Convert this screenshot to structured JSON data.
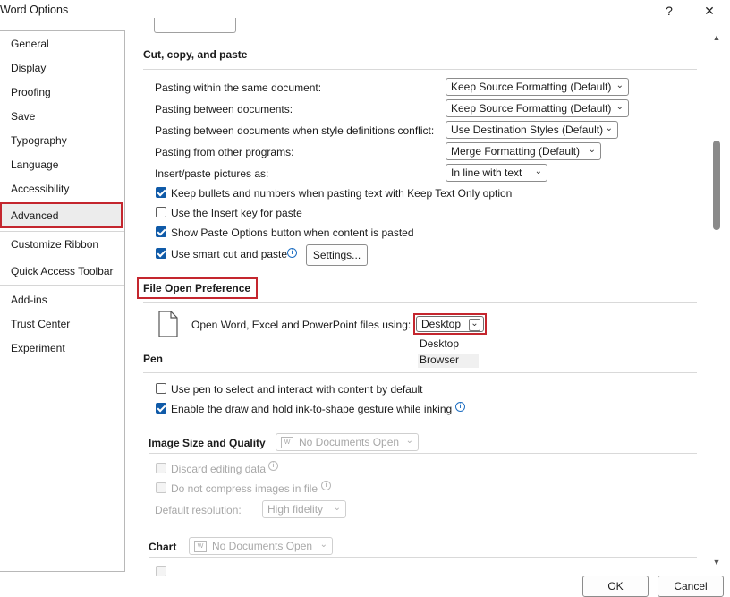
{
  "window": {
    "title": "Word Options",
    "help_glyph": "?",
    "close_glyph": "✕"
  },
  "sidebar": {
    "items": [
      {
        "label": "General"
      },
      {
        "label": "Display"
      },
      {
        "label": "Proofing"
      },
      {
        "label": "Save"
      },
      {
        "label": "Typography"
      },
      {
        "label": "Language"
      },
      {
        "label": "Accessibility"
      },
      {
        "label": "Advanced"
      },
      {
        "label": "Customize Ribbon"
      },
      {
        "label": "Quick Access Toolbar"
      },
      {
        "label": "Add-ins"
      },
      {
        "label": "Trust Center"
      },
      {
        "label": "Experiment"
      }
    ],
    "selected": "Advanced"
  },
  "cut_copy_paste": {
    "heading": "Cut, copy, and paste",
    "rows": [
      {
        "label": "Pasting within the same document:",
        "value": "Keep Source Formatting (Default)"
      },
      {
        "label": "Pasting between documents:",
        "value": "Keep Source Formatting (Default)"
      },
      {
        "label": "Pasting between documents when style definitions conflict:",
        "value": "Use Destination Styles (Default)"
      },
      {
        "label": "Pasting from other programs:",
        "value": "Merge Formatting (Default)"
      },
      {
        "label": "Insert/paste pictures as:",
        "value": "In line with text"
      }
    ],
    "checkboxes": [
      {
        "label": "Keep bullets and numbers when pasting text with Keep Text Only option",
        "checked": true
      },
      {
        "label": "Use the Insert key for paste",
        "checked": false
      },
      {
        "label": "Show Paste Options button when content is pasted",
        "checked": true
      },
      {
        "label": "Use smart cut and paste",
        "checked": true
      }
    ],
    "settings_button": "Settings..."
  },
  "file_open_preference": {
    "heading": "File Open Preference",
    "label": "Open Word, Excel and PowerPoint files using:",
    "selected": "Desktop",
    "options": [
      "Desktop",
      "Browser"
    ],
    "icon": "document-icon"
  },
  "pen": {
    "heading": "Pen",
    "checkboxes": [
      {
        "label": "Use pen to select and interact with content by default",
        "checked": false
      },
      {
        "label": "Enable the draw and hold ink-to-shape gesture while inking",
        "checked": true
      }
    ]
  },
  "image_size_quality": {
    "heading": "Image Size and Quality",
    "doc_select": "No Documents Open",
    "checkboxes": [
      {
        "label": "Discard editing data",
        "checked": false
      },
      {
        "label": "Do not compress images in file",
        "checked": false
      }
    ],
    "resolution_label": "Default resolution:",
    "resolution_value": "High fidelity"
  },
  "chart": {
    "heading": "Chart",
    "doc_select": "No Documents Open"
  },
  "footer": {
    "ok": "OK",
    "cancel": "Cancel"
  },
  "colors": {
    "highlight_red": "#c4262e",
    "checkbox_blue": "#0f5aa8",
    "info_blue": "#1f6fc2"
  }
}
